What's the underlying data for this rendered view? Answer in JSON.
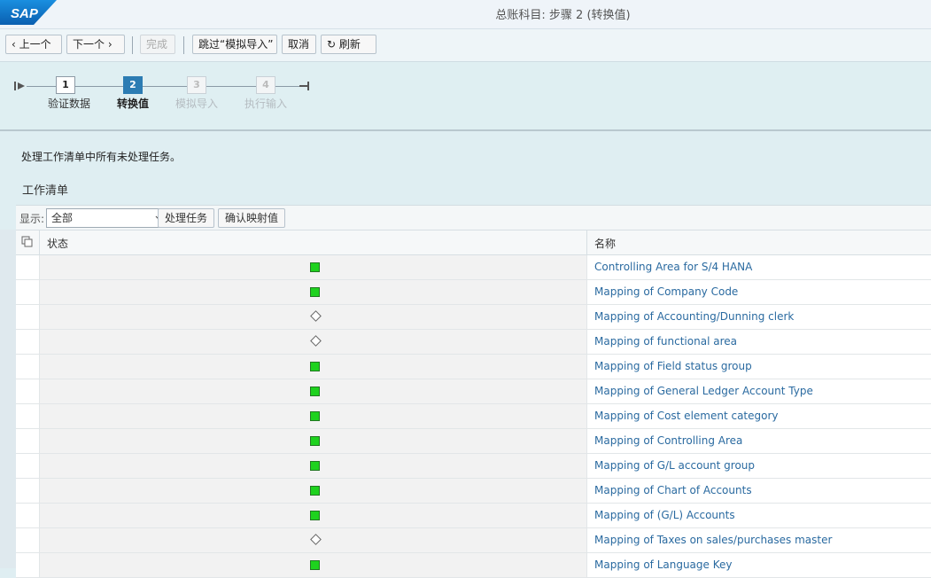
{
  "window": {
    "brand": "SAP",
    "title": "总账科目: 步骤 2  (转换值)"
  },
  "toolbar": {
    "prev_label": "上一个",
    "next_label": "下一个",
    "finish_label": "完成",
    "skip_label": "跳过“模拟导入”",
    "cancel_label": "取消",
    "refresh_label": "刷新"
  },
  "roadmap": {
    "steps": [
      {
        "number": "1",
        "label": "验证数据",
        "state": "done"
      },
      {
        "number": "2",
        "label": "转换值",
        "state": "active"
      },
      {
        "number": "3",
        "label": "模拟导入",
        "state": "inactive"
      },
      {
        "number": "4",
        "label": "执行输入",
        "state": "inactive"
      }
    ]
  },
  "content": {
    "instruction": "处理工作清单中所有未处理任务。",
    "section_title": "工作清单"
  },
  "filter": {
    "label": "显示:",
    "selected": "全部",
    "process_task_label": "处理任务",
    "confirm_mapping_label": "确认映射值"
  },
  "table": {
    "headers": {
      "status": "状态",
      "name": "名称"
    },
    "rows": [
      {
        "status": "green",
        "name": "Controlling Area for S/4 HANA"
      },
      {
        "status": "green",
        "name": "Mapping of Company Code"
      },
      {
        "status": "diamond",
        "name": "Mapping of Accounting/Dunning clerk"
      },
      {
        "status": "diamond",
        "name": "Mapping of functional area"
      },
      {
        "status": "green",
        "name": "Mapping of Field status group"
      },
      {
        "status": "green",
        "name": "Mapping of General Ledger Account Type"
      },
      {
        "status": "green",
        "name": "Mapping of Cost element category"
      },
      {
        "status": "green",
        "name": "Mapping of Controlling Area"
      },
      {
        "status": "green",
        "name": "Mapping of G/L account group"
      },
      {
        "status": "green",
        "name": "Mapping of Chart of Accounts"
      },
      {
        "status": "green",
        "name": "Mapping of (G/L) Accounts"
      },
      {
        "status": "diamond",
        "name": "Mapping of Taxes on sales/purchases master"
      },
      {
        "status": "green",
        "name": "Mapping of Language Key"
      }
    ]
  },
  "colors": {
    "accent": "#2c7cb3",
    "link": "#2a6aa0",
    "status_ok": "#1ed21e"
  }
}
